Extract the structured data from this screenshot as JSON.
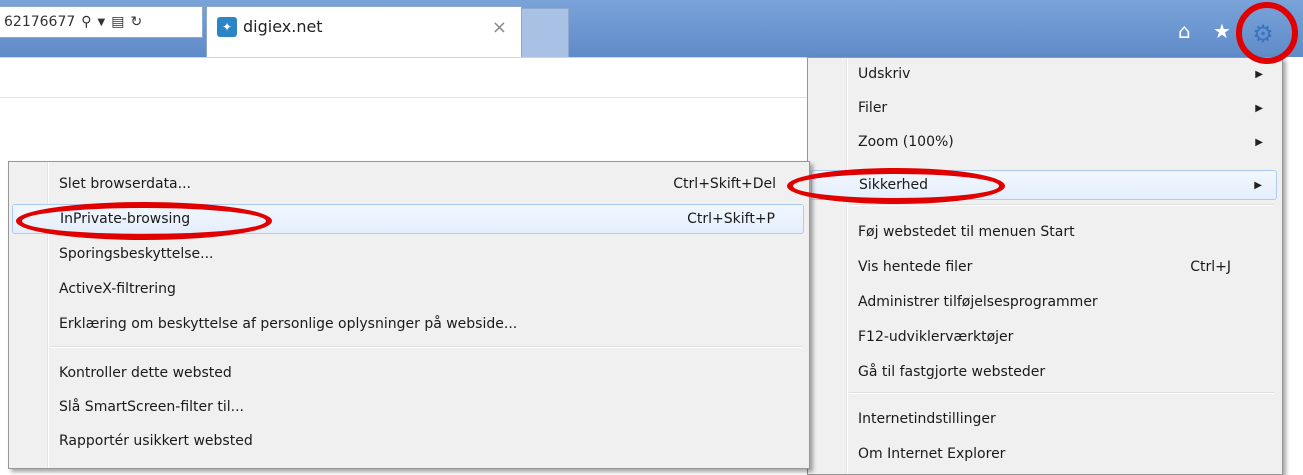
{
  "address": {
    "text": "62176677"
  },
  "tab": {
    "title": "digiex.net",
    "close": "×"
  },
  "icons": {
    "search": "search-icon",
    "dropdown": "chevron-down-icon",
    "compat": "compatibility-view-icon",
    "refresh": "refresh-icon",
    "home": "home-icon",
    "favorites": "star-icon",
    "tools": "gear-icon"
  },
  "tools_menu": {
    "items": [
      {
        "label": "Udskriv",
        "submenu": true
      },
      {
        "label": "Filer",
        "submenu": true
      },
      {
        "label": "Zoom (100%)",
        "submenu": true
      },
      {
        "label": "Sikkerhed",
        "submenu": true
      },
      {
        "label": "Føj webstedet til menuen Start"
      },
      {
        "label": "Vis hentede filer",
        "shortcut": "Ctrl+J"
      },
      {
        "label": "Administrer tilføjelsesprogrammer"
      },
      {
        "label": "F12-udviklerværktøjer"
      },
      {
        "label": "Gå til fastgjorte websteder"
      },
      {
        "label": "Internetindstillinger"
      },
      {
        "label": "Om Internet Explorer"
      }
    ]
  },
  "safety_menu": {
    "items": [
      {
        "label": "Slet browserdata...",
        "shortcut": "Ctrl+Skift+Del"
      },
      {
        "label": "InPrivate-browsing",
        "shortcut": "Ctrl+Skift+P"
      },
      {
        "label": "Sporingsbeskyttelse..."
      },
      {
        "label": "ActiveX-filtrering"
      },
      {
        "label": "Erklæring om beskyttelse af personlige oplysninger på webside..."
      },
      {
        "label": "Kontroller dette websted"
      },
      {
        "label": "Slå SmartScreen-filter til..."
      },
      {
        "label": "Rapportér usikkert websted"
      }
    ]
  },
  "colors": {
    "titlebar": "#6b95d0",
    "highlight": "#e4eefb",
    "annotation": "#e00000"
  }
}
